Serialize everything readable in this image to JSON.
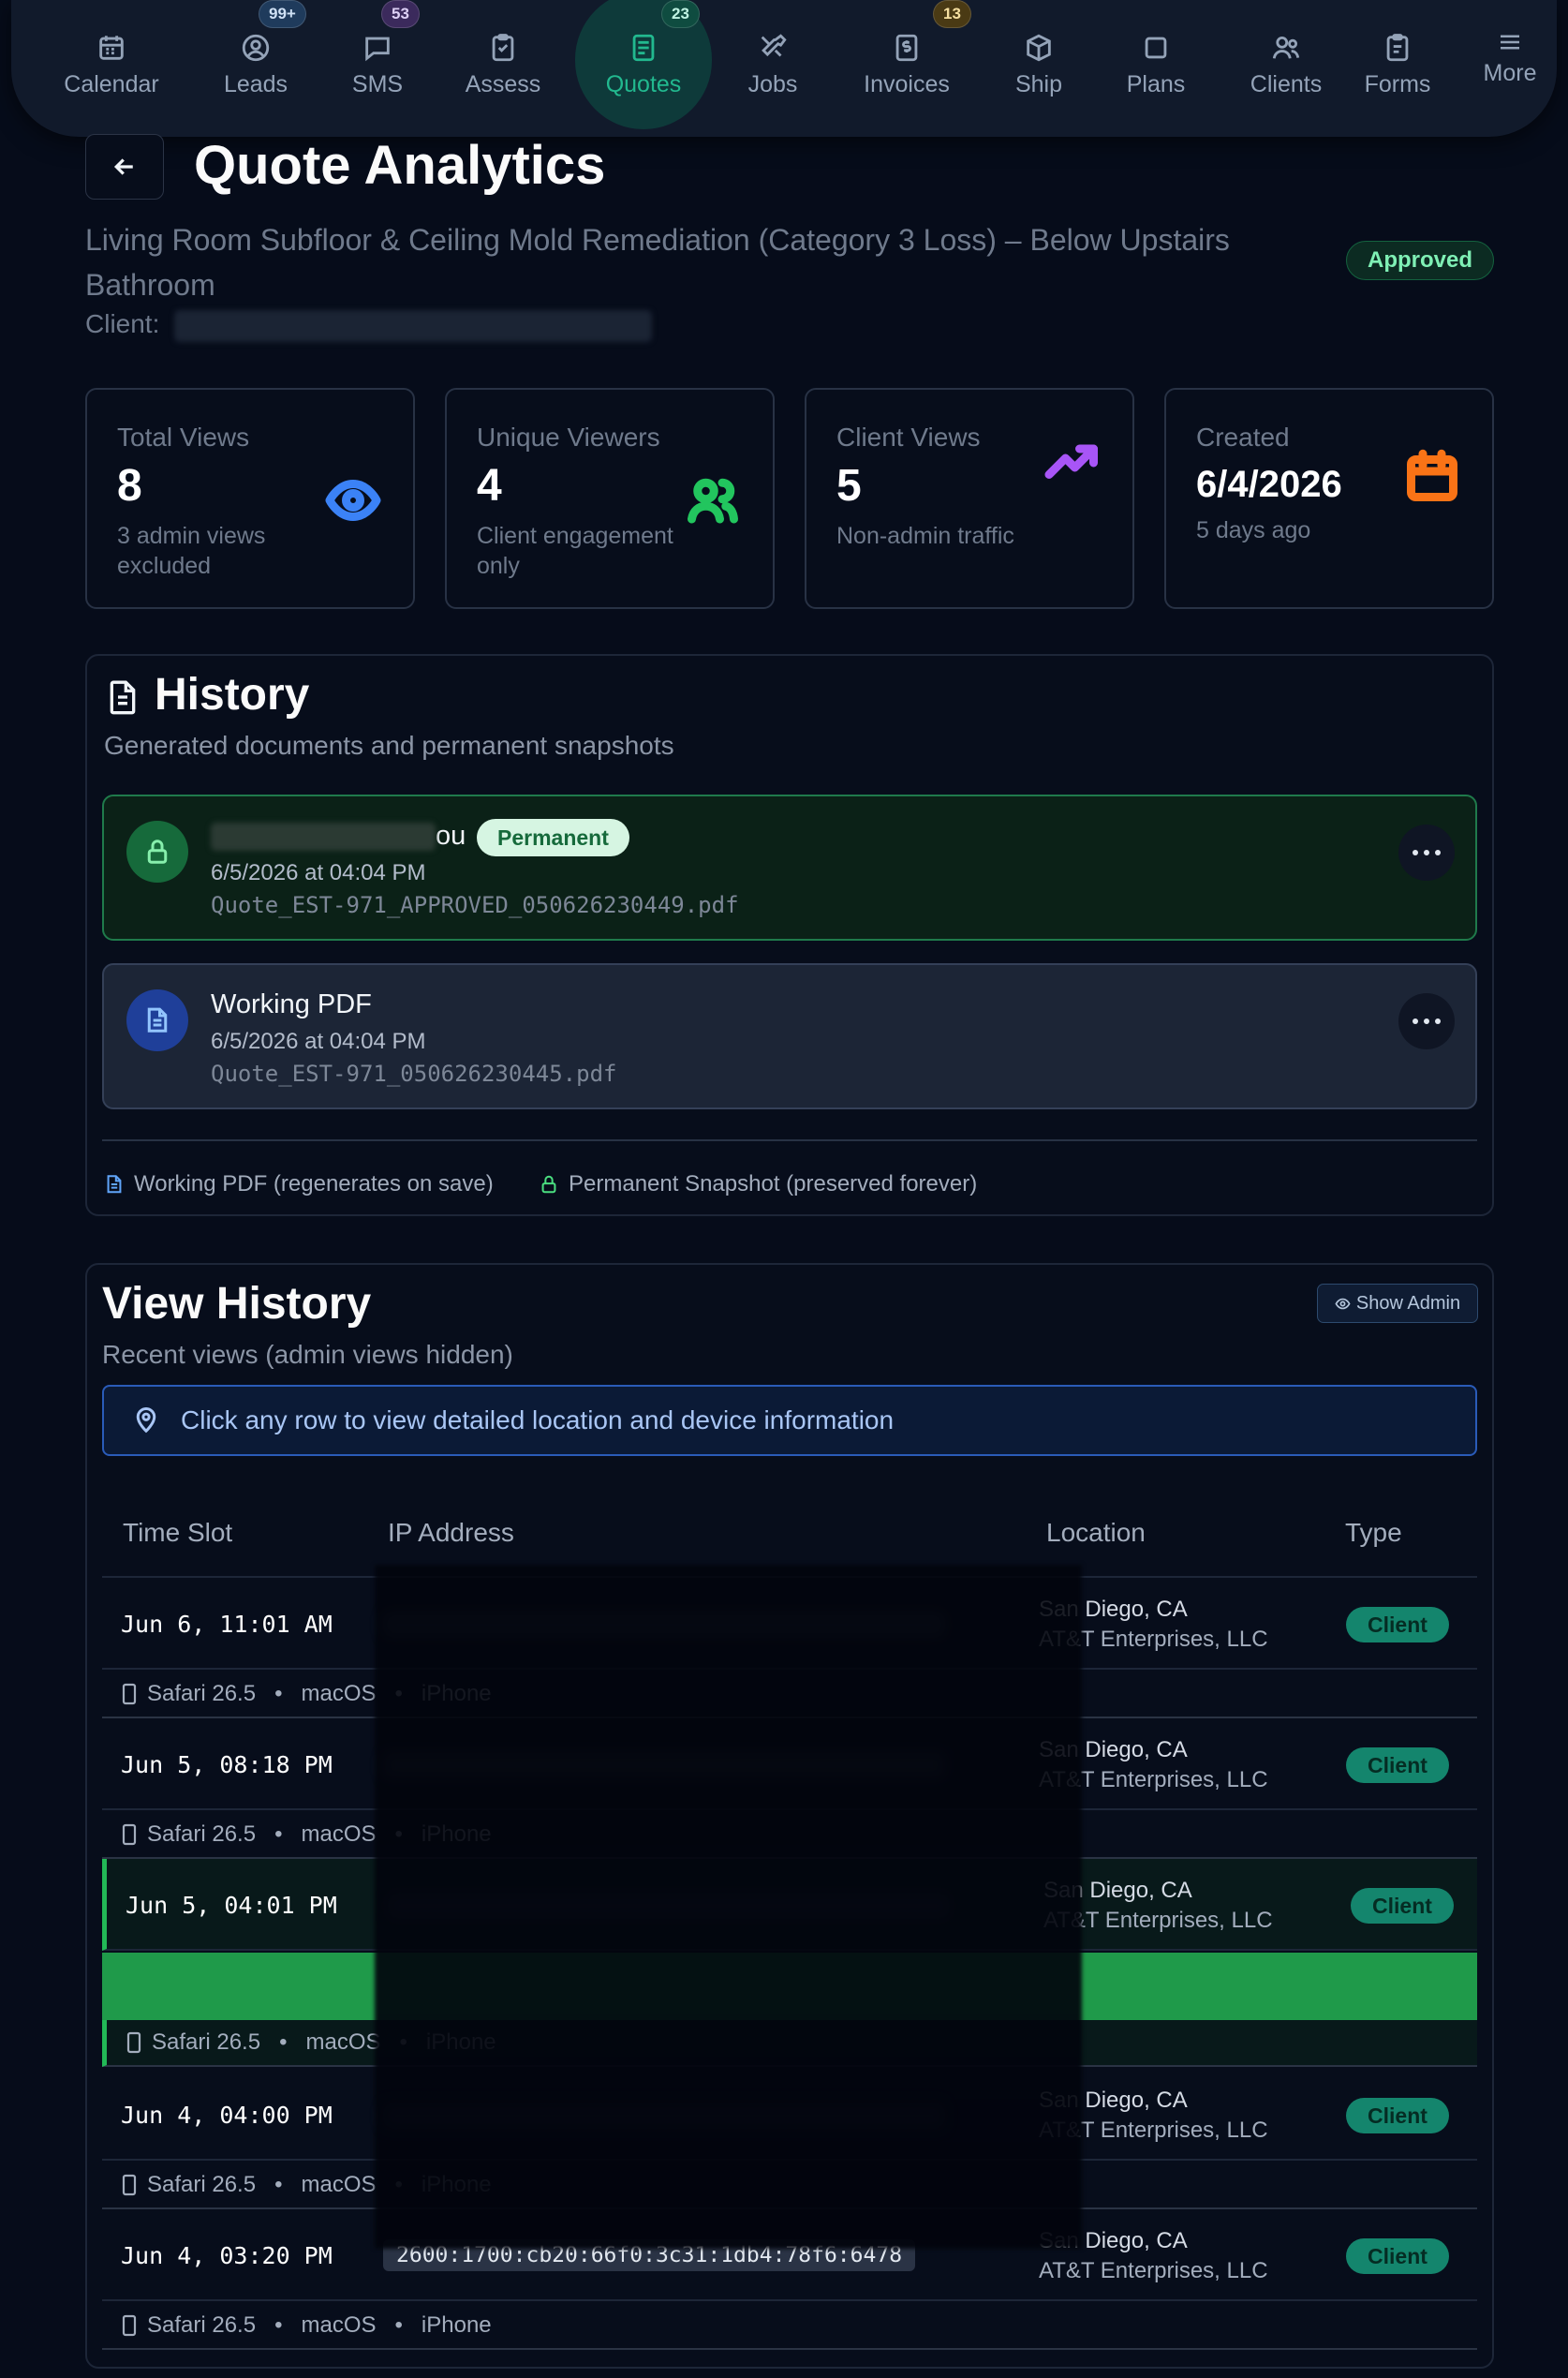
{
  "nav": {
    "items": [
      {
        "label": "Calendar",
        "icon": "calendar-icon",
        "badge": ""
      },
      {
        "label": "Leads",
        "icon": "user-circle-icon",
        "badge": "99+"
      },
      {
        "label": "SMS",
        "icon": "message-icon",
        "badge": "53"
      },
      {
        "label": "Assess",
        "icon": "clipboard-icon",
        "badge": ""
      },
      {
        "label": "Quotes",
        "icon": "quote-list-icon",
        "badge": "23"
      },
      {
        "label": "Jobs",
        "icon": "tools-icon",
        "badge": ""
      },
      {
        "label": "Invoices",
        "icon": "dollar-receipt-icon",
        "badge": "13"
      },
      {
        "label": "Ship",
        "icon": "package-icon",
        "badge": ""
      },
      {
        "label": "Plans",
        "icon": "square-icon",
        "badge": ""
      },
      {
        "label": "Clients",
        "icon": "users-icon",
        "badge": ""
      },
      {
        "label": "Forms",
        "icon": "form-icon",
        "badge": ""
      },
      {
        "label": "More",
        "icon": "menu-icon",
        "badge": ""
      }
    ],
    "active": "Quotes",
    "colors": {
      "active": "#22b98f",
      "badge_leads": "#1f3b5c",
      "badge_sms": "#3b2a5c",
      "badge_quotes": "#0f4c40",
      "badge_invoices": "#4a3a14"
    }
  },
  "header": {
    "title": "Quote Analytics",
    "subtitle": "Living Room Subfloor & Ceiling Mold Remediation (Category 3 Loss) – Below Upstairs Bathroom",
    "status": "Approved",
    "client_label": "Client:"
  },
  "stats": [
    {
      "label": "Total Views",
      "value": "8",
      "sub": "3 admin views excluded",
      "icon": "eye-icon",
      "color": "#3b82f6"
    },
    {
      "label": "Unique Viewers",
      "value": "4",
      "sub": "Client engagement only",
      "icon": "users-icon",
      "color": "#22c55e"
    },
    {
      "label": "Client Views",
      "value": "5",
      "sub": "Non-admin traffic",
      "icon": "trending-up-icon",
      "color": "#a855f7"
    },
    {
      "label": "Created",
      "value": "6/4/2026",
      "sub": "5 days ago",
      "icon": "calendar-icon",
      "color": "#f97316"
    }
  ],
  "history": {
    "title": "History",
    "subtitle": "Generated documents and permanent snapshots",
    "docs": [
      {
        "title_suffix": "ou",
        "badge": "Permanent",
        "date": "6/5/2026 at 04:04 PM",
        "file": "Quote_EST-971_APPROVED_050626230449.pdf",
        "kind": "permanent"
      },
      {
        "title": "Working PDF",
        "date": "6/5/2026 at 04:04 PM",
        "file": "Quote_EST-971_050626230445.pdf",
        "kind": "working"
      }
    ],
    "legend": {
      "working": "Working PDF (regenerates on save)",
      "permanent": "Permanent Snapshot (preserved forever)"
    }
  },
  "view_history": {
    "title": "View History",
    "subtitle": "Recent views (admin views hidden)",
    "show_admin": "Show Admin",
    "banner": "Click any row to view detailed location and device information",
    "columns": [
      "Time Slot",
      "IP Address",
      "Location",
      "Type"
    ],
    "rows": [
      {
        "time": "Jun 6, 11:01 AM",
        "city": "San Diego, CA",
        "isp": "AT&T Enterprises, LLC",
        "type": "Client",
        "browser": "Safari 26.5",
        "os": "macOS",
        "device": "iPhone"
      },
      {
        "time": "Jun 5, 08:18 PM",
        "city": "San Diego, CA",
        "isp": "AT&T Enterprises, LLC",
        "type": "Client",
        "browser": "Safari 26.5",
        "os": "macOS",
        "device": "iPhone"
      },
      {
        "time": "Jun 5, 04:01 PM",
        "city": "San Diego, CA",
        "isp": "AT&T Enterprises, LLC",
        "type": "Client",
        "browser": "Safari 26.5",
        "os": "macOS",
        "device": "iPhone"
      },
      {
        "time": "Jun 4, 04:00 PM",
        "city": "San Diego, CA",
        "isp": "AT&T Enterprises, LLC",
        "type": "Client",
        "browser": "Safari 26.5",
        "os": "macOS",
        "device": "iPhone"
      },
      {
        "time": "Jun 4, 03:20 PM",
        "ip": "2600:1700:cb20:66f0:3c31:1db4:78f6:6478",
        "city": "San Diego, CA",
        "isp": "AT&T Enterprises, LLC",
        "type": "Client",
        "browser": "Safari 26.5",
        "os": "macOS",
        "device": "iPhone"
      }
    ]
  }
}
